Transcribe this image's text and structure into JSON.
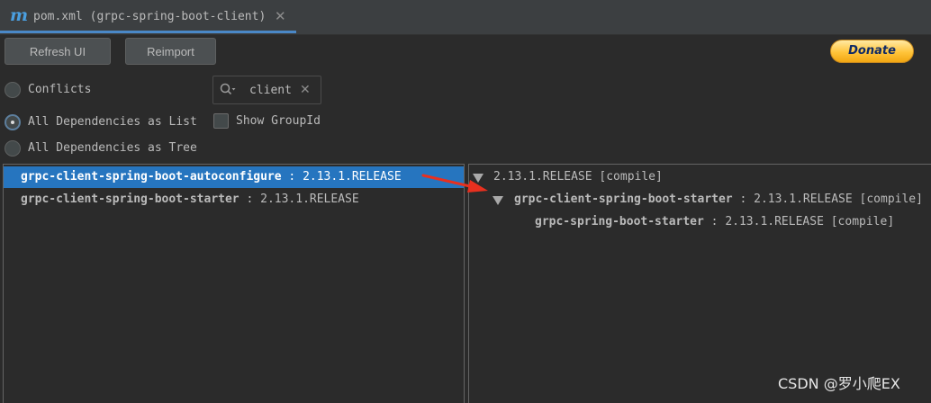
{
  "tab": {
    "icon": "maven-m-icon",
    "icon_glyph": "m",
    "title": "pom.xml (grpc-spring-boot-client)",
    "close_glyph": "✕"
  },
  "toolbar": {
    "refresh_label": "Refresh UI",
    "reimport_label": "Reimport",
    "donate_label": "Donate"
  },
  "modes": {
    "conflicts_label": "Conflicts",
    "list_label": "All Dependencies as List",
    "tree_label": "All Dependencies as Tree",
    "selected": "list"
  },
  "search": {
    "value": "client",
    "clear_glyph": "✕",
    "icon": "search-icon"
  },
  "options": {
    "show_group_id_label": "Show GroupId",
    "show_group_id_checked": false
  },
  "list": {
    "items": [
      {
        "artifact": "grpc-client-spring-boot-autoconfigure",
        "version": " : 2.13.1.RELEASE",
        "selected": true
      },
      {
        "artifact": "grpc-client-spring-boot-starter",
        "version": " : 2.13.1.RELEASE",
        "selected": false
      }
    ]
  },
  "tree": {
    "root": "2.13.1.RELEASE [compile]",
    "nodes": [
      {
        "artifact": "grpc-client-spring-boot-starter",
        "detail": " : 2.13.1.RELEASE [compile]"
      },
      {
        "artifact": "grpc-spring-boot-starter",
        "detail": " : 2.13.1.RELEASE [compile]"
      }
    ]
  },
  "colors": {
    "background": "#2b2b2b",
    "selection": "#2675bf",
    "annotation_arrow": "#e8301f",
    "donate": "#ffc43a"
  },
  "watermark": "CSDN @罗小爬EX"
}
